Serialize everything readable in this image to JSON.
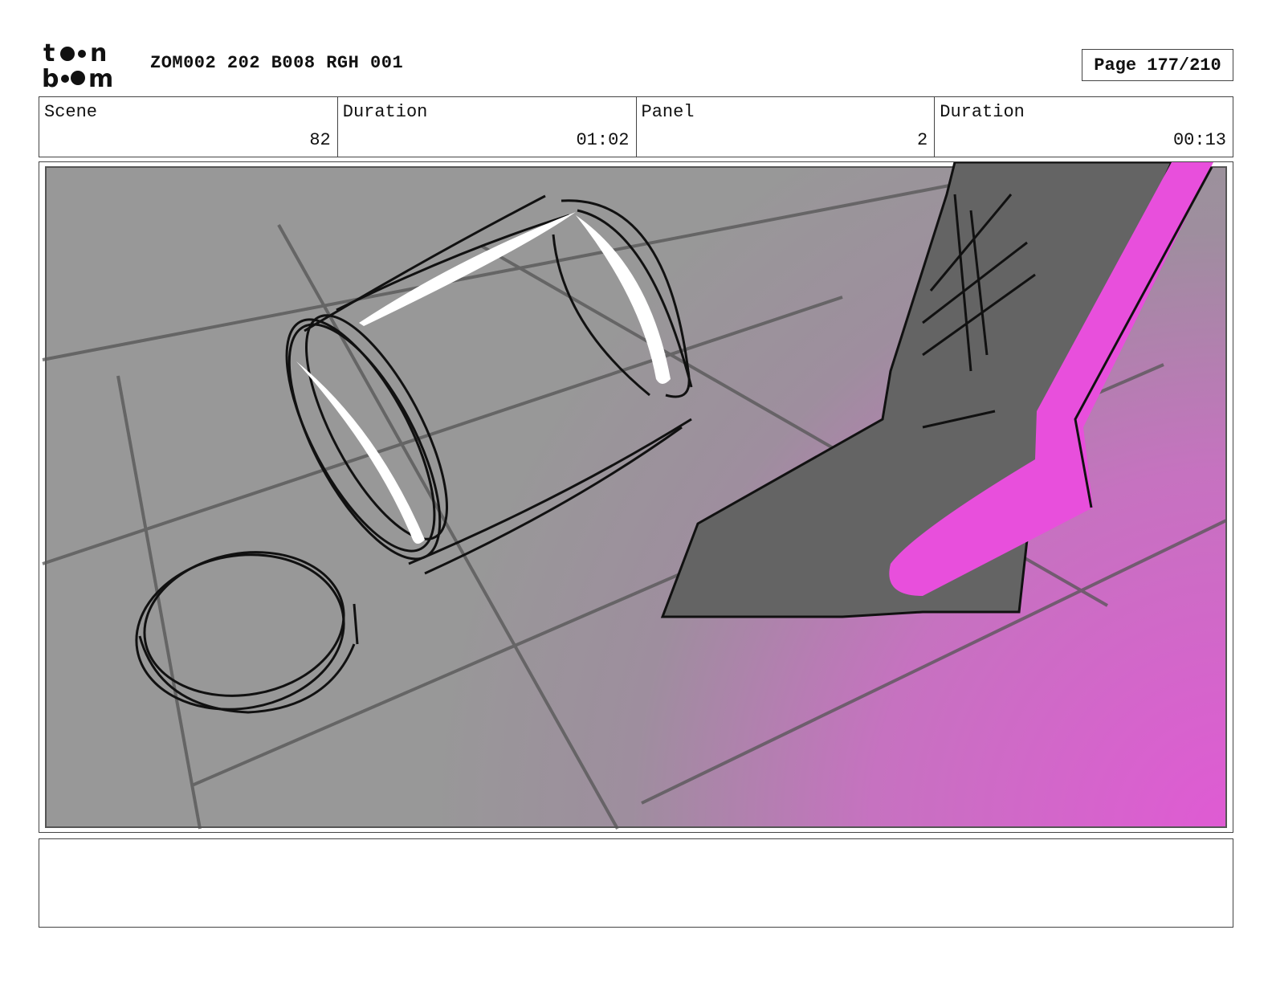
{
  "header": {
    "logo_top": "t••n",
    "logo_bottom": "b••m",
    "title": "ZOM002 202 B008 RGH 001",
    "page": "Page 177/210"
  },
  "info": {
    "scene_label": "Scene",
    "scene_value": "82",
    "duration_label": "Duration",
    "duration_value": "01:02",
    "panel_label": "Panel",
    "panel_value": "2",
    "panel_duration_label": "Duration",
    "panel_duration_value": "00:13"
  },
  "panel_image": {
    "description_icon": "storyboard-sketch",
    "colors": {
      "floor": "#989898",
      "magenta": "#e84fdc",
      "boot": "#646464"
    }
  },
  "notes": {
    "text": ""
  }
}
